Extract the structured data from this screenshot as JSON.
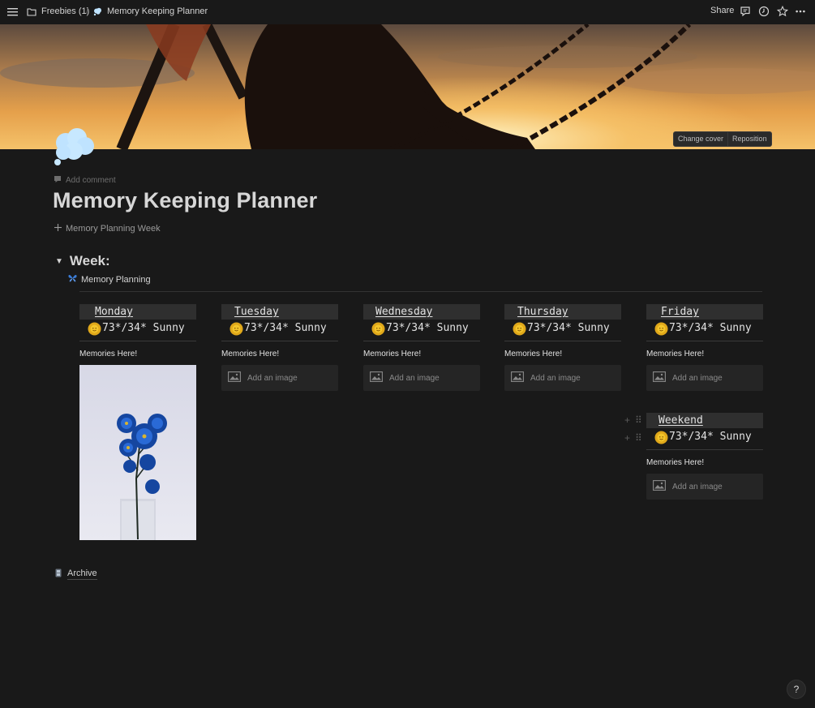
{
  "topbar": {
    "breadcrumb_parent": "Freebies (1)",
    "breadcrumb_separator": "/",
    "breadcrumb_current": "Memory Keeping Planner",
    "share_label": "Share",
    "icons": [
      "menu-icon",
      "folder-icon",
      "thought-bubble-icon",
      "comment-icon",
      "clock-history-icon",
      "star-icon",
      "more-icon"
    ]
  },
  "cover": {
    "change_cover_label": "Change cover",
    "reposition_label": "Reposition"
  },
  "page": {
    "icon": "thought-bubble-icon",
    "add_comment_label": "Add comment",
    "title": "Memory Keeping Planner",
    "subpage_link": "Memory Planning Week"
  },
  "toggle": {
    "heading": "Week:",
    "link_label": "Memory Planning"
  },
  "days": [
    {
      "name": "Monday",
      "weather": "73*/34* Sunny",
      "memories": "Memories Here!",
      "has_photo": true
    },
    {
      "name": "Tuesday",
      "weather": "73*/34* Sunny",
      "memories": "Memories Here!",
      "add_image": "Add an image"
    },
    {
      "name": "Wednesday",
      "weather": "73*/34* Sunny",
      "memories": "Memories Here!",
      "add_image": "Add an image"
    },
    {
      "name": "Thursday",
      "weather": "73*/34* Sunny",
      "memories": "Memories Here!",
      "add_image": "Add an image"
    },
    {
      "name": "Friday",
      "weather": "73*/34* Sunny",
      "memories": "Memories Here!",
      "add_image": "Add an image"
    },
    {
      "name": "Weekend",
      "weather": "73*/34* Sunny",
      "memories": "Memories Here!",
      "add_image": "Add an image"
    }
  ],
  "archive_label": "Archive",
  "help_label": "?",
  "colors": {
    "background": "#191919",
    "card_header": "#2f2f2f",
    "text": "#d4d4d4",
    "accent_blue": "#3a7bd5"
  }
}
